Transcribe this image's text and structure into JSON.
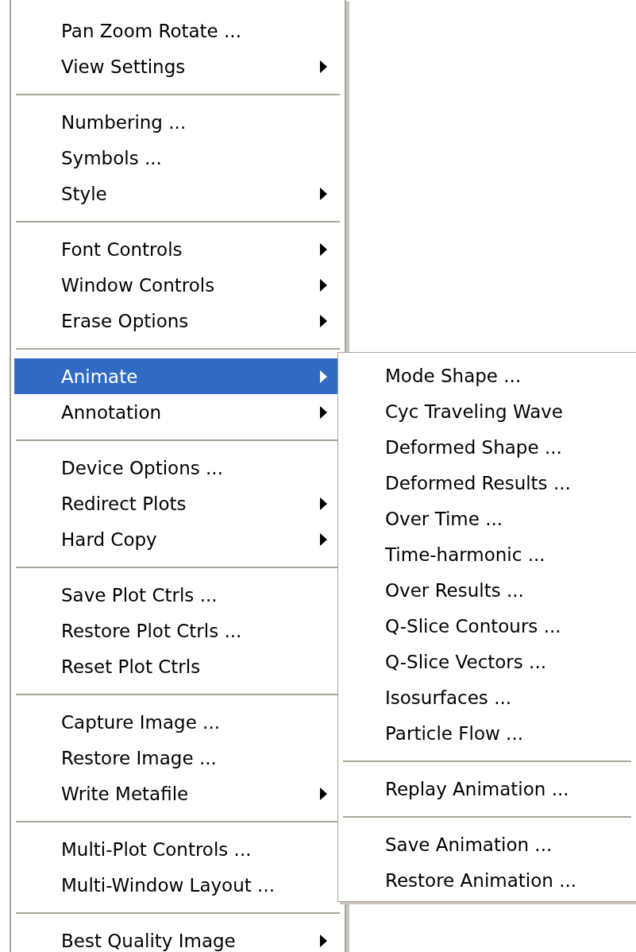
{
  "menu": {
    "groups": [
      {
        "items": [
          {
            "label": "Pan Zoom Rotate  ...",
            "has_submenu": false,
            "selected": false
          },
          {
            "label": "View Settings",
            "has_submenu": true,
            "selected": false
          }
        ]
      },
      {
        "items": [
          {
            "label": "Numbering  ...",
            "has_submenu": false,
            "selected": false
          },
          {
            "label": "Symbols  ...",
            "has_submenu": false,
            "selected": false
          },
          {
            "label": "Style",
            "has_submenu": true,
            "selected": false
          }
        ]
      },
      {
        "items": [
          {
            "label": "Font Controls",
            "has_submenu": true,
            "selected": false
          },
          {
            "label": "Window Controls",
            "has_submenu": true,
            "selected": false
          },
          {
            "label": "Erase Options",
            "has_submenu": true,
            "selected": false
          }
        ]
      },
      {
        "items": [
          {
            "label": "Animate",
            "has_submenu": true,
            "selected": true
          },
          {
            "label": "Annotation",
            "has_submenu": true,
            "selected": false
          }
        ]
      },
      {
        "items": [
          {
            "label": "Device Options ...",
            "has_submenu": false,
            "selected": false
          },
          {
            "label": "Redirect Plots",
            "has_submenu": true,
            "selected": false
          },
          {
            "label": "Hard Copy",
            "has_submenu": true,
            "selected": false
          }
        ]
      },
      {
        "items": [
          {
            "label": "Save Plot Ctrls  ...",
            "has_submenu": false,
            "selected": false
          },
          {
            "label": "Restore Plot Ctrls  ...",
            "has_submenu": false,
            "selected": false
          },
          {
            "label": "Reset Plot Ctrls",
            "has_submenu": false,
            "selected": false
          }
        ]
      },
      {
        "items": [
          {
            "label": "Capture Image  ...",
            "has_submenu": false,
            "selected": false
          },
          {
            "label": "Restore Image  ...",
            "has_submenu": false,
            "selected": false
          },
          {
            "label": "Write Metafile",
            "has_submenu": true,
            "selected": false
          }
        ]
      },
      {
        "items": [
          {
            "label": "Multi-Plot Controls  ...",
            "has_submenu": false,
            "selected": false
          },
          {
            "label": "Multi-Window Layout  ...",
            "has_submenu": false,
            "selected": false
          }
        ]
      },
      {
        "items": [
          {
            "label": "Best Quality Image",
            "has_submenu": true,
            "selected": false
          }
        ]
      }
    ]
  },
  "submenu": {
    "groups": [
      {
        "items": [
          {
            "label": "Mode Shape ...",
            "selected": false
          },
          {
            "label": "Cyc Traveling Wave",
            "selected": false
          },
          {
            "label": "Deformed Shape ...",
            "selected": false
          },
          {
            "label": "Deformed Results ...",
            "selected": false
          },
          {
            "label": "Over Time ...",
            "selected": false
          },
          {
            "label": "Time-harmonic ...",
            "selected": false
          },
          {
            "label": "Over Results ...",
            "selected": false
          },
          {
            "label": "Q-Slice Contours ...",
            "selected": false
          },
          {
            "label": "Q-Slice Vectors ...",
            "selected": false
          },
          {
            "label": "Isosurfaces ...",
            "selected": false
          },
          {
            "label": "Particle Flow ...",
            "selected": false
          }
        ]
      },
      {
        "items": [
          {
            "label": "Replay Animation ...",
            "selected": false
          }
        ]
      },
      {
        "items": [
          {
            "label": "Save Animation ...",
            "selected": false
          },
          {
            "label": "Restore Animation ...",
            "selected": false
          }
        ]
      }
    ]
  }
}
